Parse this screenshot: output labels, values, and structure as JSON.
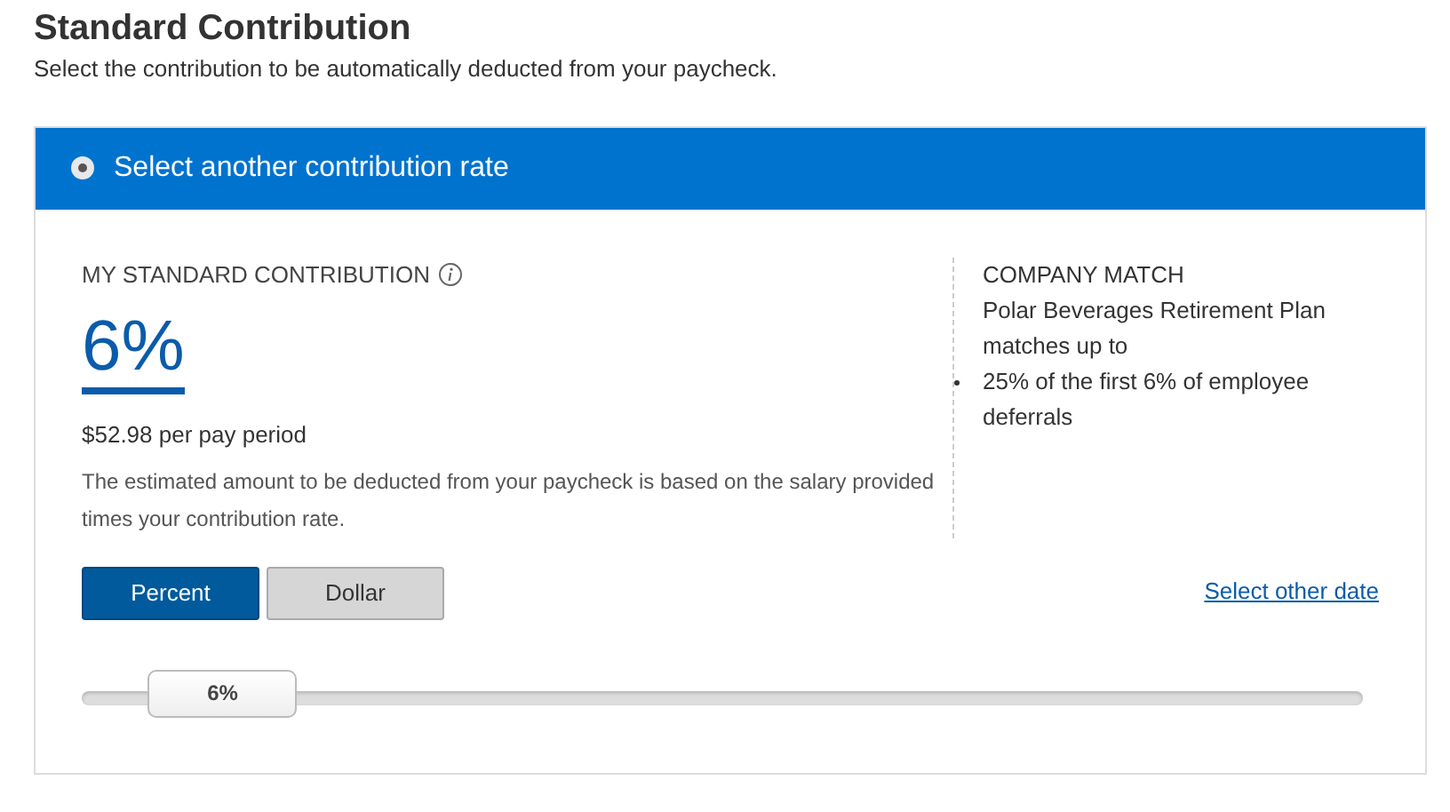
{
  "page": {
    "title": "Standard Contribution",
    "subtitle": "Select the contribution to be automatically deducted from your paycheck."
  },
  "option": {
    "label": "Select another contribution rate",
    "selected": true
  },
  "contribution": {
    "heading": "MY STANDARD CONTRIBUTION",
    "rate": "6%",
    "amount": "$52.98 per pay period",
    "note": "The estimated amount to be deducted from your paycheck is based on the salary provided times your contribution rate."
  },
  "company_match": {
    "heading": "COMPANY MATCH",
    "text": "Polar Beverages Retirement Plan matches up to",
    "items": [
      "25% of the first 6% of employee deferrals"
    ]
  },
  "modes": [
    {
      "label": "Percent",
      "selected": true
    },
    {
      "label": "Dollar",
      "selected": false
    }
  ],
  "date_link": "Select other date",
  "slider": {
    "level": 0.11,
    "reading": "6%"
  }
}
